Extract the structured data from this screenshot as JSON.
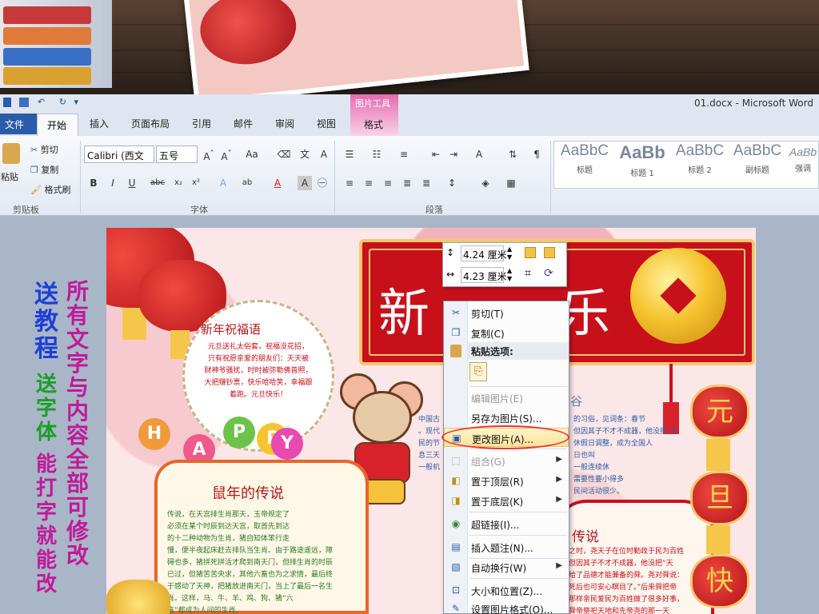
{
  "window": {
    "title": "01.docx - Microsoft Word",
    "contextual_tab_group": "图片工具",
    "contextual_tab": "格式"
  },
  "tabs": [
    "文件",
    "开始",
    "插入",
    "页面布局",
    "引用",
    "邮件",
    "审阅",
    "视图"
  ],
  "ribbon": {
    "clipboard": {
      "paste": "粘贴",
      "cut": "剪切",
      "copy": "复制",
      "format_painter": "格式刷",
      "group": "剪贴板"
    },
    "font": {
      "name": "Calibri (西文",
      "size": "五号",
      "group": "字体"
    },
    "paragraph": {
      "group": "段落"
    },
    "styles": [
      {
        "sample": "AaBbC",
        "label": "标题"
      },
      {
        "sample": "AaBb",
        "label": "标题 1"
      },
      {
        "sample": "AaBbC",
        "label": "标题 2"
      },
      {
        "sample": "AaBbC",
        "label": "副标题"
      },
      {
        "sample": "AaBb",
        "label": "强调"
      }
    ]
  },
  "size_toolbar": {
    "height": "4.24 厘米",
    "width": "4.23 厘米"
  },
  "context_menu": {
    "header": "粘贴选项:",
    "items": [
      {
        "label": "剪切(T)",
        "icon": "scissors-icon",
        "enabled": true
      },
      {
        "label": "复制(C)",
        "icon": "copy-icon",
        "enabled": true
      },
      {
        "label": "编辑图片(E)",
        "icon": "",
        "enabled": false
      },
      {
        "label": "另存为图片(S)...",
        "icon": "",
        "enabled": true
      },
      {
        "label": "更改图片(A)...",
        "icon": "change-picture-icon",
        "enabled": true,
        "highlighted": true
      },
      {
        "label": "组合(G)",
        "icon": "group-icon",
        "enabled": false,
        "submenu": true
      },
      {
        "label": "置于顶层(R)",
        "icon": "bring-front-icon",
        "enabled": true,
        "submenu": true
      },
      {
        "label": "置于底层(K)",
        "icon": "send-back-icon",
        "enabled": true,
        "submenu": true
      },
      {
        "label": "超链接(I)...",
        "icon": "hyperlink-icon",
        "enabled": true
      },
      {
        "label": "插入题注(N)...",
        "icon": "caption-icon",
        "enabled": true
      },
      {
        "label": "自动换行(W)",
        "icon": "wrap-icon",
        "enabled": true,
        "submenu": true
      },
      {
        "label": "大小和位置(Z)...",
        "icon": "size-icon",
        "enabled": true
      },
      {
        "label": "设置图片格式(O)...",
        "icon": "format-picture-icon",
        "enabled": true
      }
    ]
  },
  "poster": {
    "banner_visible": [
      "新",
      "乐"
    ],
    "blessing_title": "新年祝福语",
    "blessing_text": "元旦送礼太俗套，祝福没花招，\n只有祝愿亲爱的朋友们：天天被\n财神爷骚扰，时时被弥勒佛普照，\n大把赚钞票，快乐哈哈笑，幸福跟\n着跑。元旦快乐！",
    "happy_letters": [
      "H",
      "A",
      "P",
      "P",
      "Y"
    ],
    "legend_title": "鼠年的传说",
    "legend_text": "传说，在天宫排生肖那天，玉帝规定了\n必须在某个时辰到达天宫，取首先到达\n的十二种动物为生肖，猪自知体笨行走\n慢，便半夜起床赶去排队当生肖。由于路途遥远，障\n碍也多，猪拼死拼活才爬到南天门，但排生肖的时辰\n已过，但猪苦苦央求，其他六畜也为之求情，最后终\n于感动了天神，把猪放进南天门，当上了最后一名生\n肖。这样，马、牛、羊、鸡、狗、猪“六\n畜”都成为人间的生肖。",
    "customs_fragment": "谷",
    "customs_text": "的习俗，见词条：春节\n但因其子不才不成器，他没把“天\n休假日调整，成为全国人\n日也叫\n一般连续休\n需要性要小得多\n民间活动很少。",
    "customs_left": "中国古\n。现代\n民的节\n息三天\n一般机",
    "legend2_title": "传说",
    "legend2_text": "之时，尧天子在位时勤政于民为百姓\n但因其子不才不成器，他没把“天\n给了品德才能兼备的舜。尧对舜说：\n死后也可安心瞑目了。”后来舜把帝\n那样亲民爱民为百姓做了很多好事，\n舜帝祭祀天地和先帝尧的那一天",
    "lantern_chars": [
      "元",
      "旦",
      "快"
    ]
  },
  "promo": {
    "col1": "所有文字与内容全部可修改",
    "col2a": "送教程",
    "col2b": "送字体",
    "col2c": "能打字就能改"
  }
}
